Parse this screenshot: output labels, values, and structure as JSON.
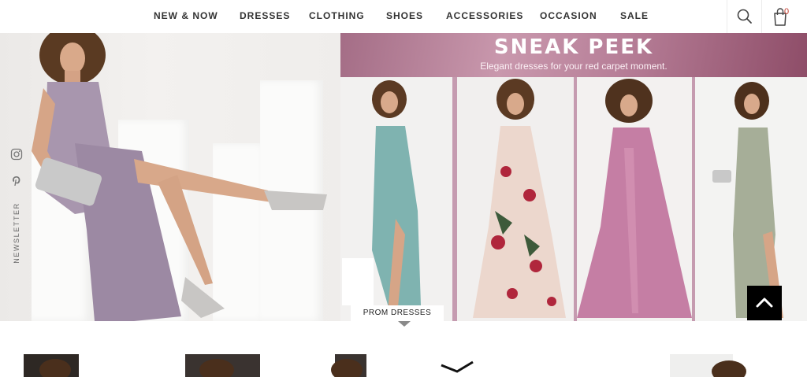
{
  "nav": {
    "items": [
      {
        "label": "NEW & NOW"
      },
      {
        "label": "DRESSES"
      },
      {
        "label": "CLOTHING"
      },
      {
        "label": "SHOES"
      },
      {
        "label": "ACCESSORIES"
      },
      {
        "label": "OCCASION"
      },
      {
        "label": "SALE"
      }
    ]
  },
  "header": {
    "search_icon": "search-icon",
    "cart_icon": "shopping-bag-icon",
    "cart_count": "0"
  },
  "hero": {
    "title": "SNEAK PEEK",
    "subtitle": "Elegant dresses for your red carpet moment.",
    "category_label": "PROM DRESSES"
  },
  "social": {
    "icons": [
      "instagram-icon",
      "pinterest-icon"
    ],
    "newsletter_label": "NEWSLETTER"
  },
  "back_to_top_icon": "chevron-up-icon",
  "colors": {
    "accent": "#b77f98",
    "nav_text": "#333333",
    "cart_badge": "#c0392b",
    "back_to_top_bg": "#000000"
  }
}
